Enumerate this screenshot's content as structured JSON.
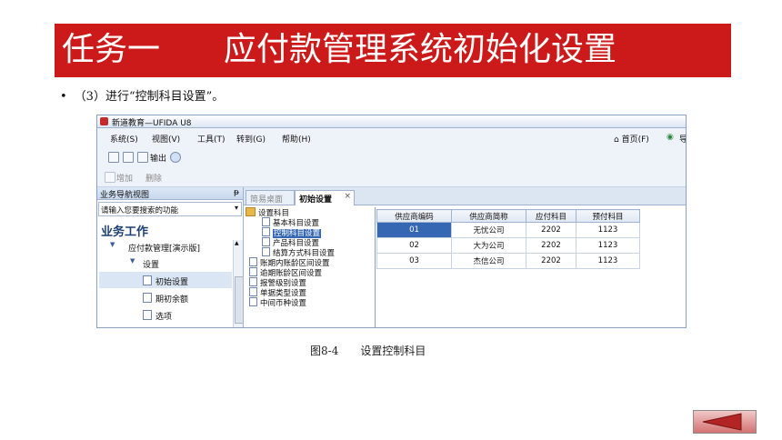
{
  "slide": {
    "title_part1": "任务一",
    "title_part2": "应付款管理系统初始化设置",
    "bullet_symbol": "•",
    "bullet_text": "（3）进行“控制科目设置”。",
    "caption_fig": "图8-4",
    "caption_text": "设置控制科目",
    "colors": {
      "banner": "#cc1a1a",
      "selected": "#3567b3"
    }
  },
  "window": {
    "title": "新道教育—UFIDA U8",
    "menu": [
      "系统(S)",
      "视图(V)",
      "工具(T)",
      "转到(G)",
      "帮助(H)"
    ],
    "menu_right": {
      "home": "首页(F)",
      "cut": "导"
    },
    "toolbar1": {
      "output_label": "输出"
    },
    "toolbar2": {
      "add_label": "增加",
      "delete_label": "删除"
    }
  },
  "nav": {
    "pane_title": "业务导航视图",
    "pin": "ᵽ",
    "search_placeholder": "请输入您要搜索的功能",
    "section_title": "业务工作",
    "items": [
      {
        "label": "应付款管理[演示版]",
        "expanded": true
      },
      {
        "label": "设置",
        "expanded": true
      },
      {
        "label": "初始设置",
        "selected": true
      },
      {
        "label": "期初余额"
      },
      {
        "label": "选项"
      }
    ]
  },
  "tabs": [
    {
      "label": "简易桌面",
      "active": false
    },
    {
      "label": "初始设置",
      "active": true,
      "close": "×"
    }
  ],
  "tree": [
    {
      "label": "设置科目",
      "type": "folder",
      "level": 0
    },
    {
      "label": "基本科目设置",
      "level": 1
    },
    {
      "label": "控制科目设置",
      "level": 1,
      "selected": true
    },
    {
      "label": "产品科目设置",
      "level": 1
    },
    {
      "label": "结算方式科目设置",
      "level": 1
    },
    {
      "label": "账期内账龄区间设置",
      "level": 0
    },
    {
      "label": "逾期账龄区间设置",
      "level": 0
    },
    {
      "label": "报警级别设置",
      "level": 0
    },
    {
      "label": "单据类型设置",
      "level": 0
    },
    {
      "label": "中间币种设置",
      "level": 0
    }
  ],
  "grid": {
    "columns": [
      "供应商编码",
      "供应商简称",
      "应付科目",
      "预付科目"
    ],
    "rows": [
      [
        "01",
        "无忧公司",
        "2202",
        "1123"
      ],
      [
        "02",
        "大为公司",
        "2202",
        "1123"
      ],
      [
        "03",
        "杰信公司",
        "2202",
        "1123"
      ]
    ]
  }
}
